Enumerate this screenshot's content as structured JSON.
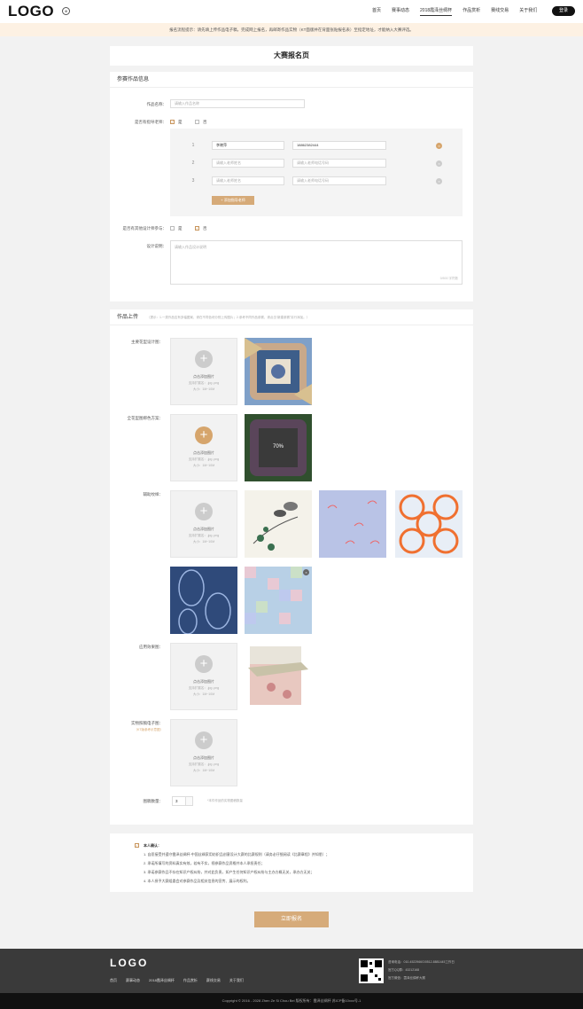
{
  "header": {
    "logo": "LOGO",
    "lang_icon": "globe-icon",
    "nav": [
      "首页",
      "赛事动态",
      "2018霞泽丝绸杯",
      "作品赏析",
      "赛线交易",
      "关于我们"
    ],
    "active_nav": "2018霞泽丝绸杯",
    "login": "登录"
  },
  "notice": "报名流程提示：请先填上传作品电子稿，完成网上报名，再邮寄作品实物（KT面版并在背面张贴报名表）至指定地址，才能纳入大赛评选。",
  "page_title": "大赛报名页",
  "info": {
    "heading": "参赛作品信息",
    "name_label": "作品名称：",
    "name_placeholder": "请输入作品名称",
    "teacher_label": "是否有指导老师：",
    "yes": "是",
    "no": "否",
    "teachers": [
      {
        "num": "1",
        "name": "李晓萍",
        "phone": "18862382444"
      },
      {
        "num": "2",
        "name": "请输入老师姓名",
        "phone": "请输入老师电话号码"
      },
      {
        "num": "3",
        "name": "请输入老师姓名",
        "phone": "请输入老师电话号码"
      }
    ],
    "add_teacher": "+ 添加指导老师",
    "other_label": "是否有其他设计师参与：",
    "desc_label": "设计说明：",
    "desc_placeholder": "请输入作品设计说明",
    "desc_count": "0/500 字符数"
  },
  "upload": {
    "heading": "作品上传",
    "hint": "（提示：1.一类作品应有多幅图案，请在不同色块分别上传图片；2.参考不同作品参赛，请点击“新建参赛”另行添加。）",
    "main_label": "主要花型设计图：",
    "color_label": "全花型图绑色方案：",
    "aux_label": "辅助纹样：",
    "effect_label": "应用效果图：",
    "kt_label": "实物照稿电子图：",
    "kt_note": "（KT版参考示意图）",
    "add_text": "点击添加图片",
    "ext_text": "支持扩展名：.jpg .png",
    "size_text": "大小：1M~10M",
    "progress": "70%",
    "count_label": "图稿数量：",
    "count_value": "3",
    "count_hint": "*本件作品的实物图稿数量"
  },
  "confirm": {
    "title": "本人确认：",
    "items": [
      "1. 自愿接受并遵守霞泽丝绸杯·中国丝绸家用纺织品创意设计大赛的比赛规则（请务必仔细阅读《比赛章程》并知悉）；",
      "2. 承诺所填写的资料真实有效，若有不实，视参赛作品资格并本人承担责任；",
      "3. 承诺参赛作品不存在知识产权纠纷，并对此负责，如产生任何知识产权纠纷与主办方概无关，承办方无关；",
      "4. 本人授予大赛组委会对参赛作品及相关信息的宣传、展示的权利。"
    ]
  },
  "submit": "立即报名",
  "footer": {
    "logo": "LOGO",
    "nav": [
      "首页",
      "赛事动态",
      "2018霞泽丝绸杯",
      "作品赏析",
      "赛线交易",
      "关于我们"
    ],
    "info": [
      "咨询电话：010-4522966G/0512-8881445工作日",
      "官方QQ群：43212168",
      "官方微信：霞泽丝绸杯大赛"
    ],
    "copyright": "Copyright © 2016 - 2028 Zhen Ze Si Chou Bei   版权所有：霞泽丝绸杯   苏ICP备10xxx号-1"
  },
  "colors": {
    "accent": "#d6aa78",
    "dark": "#3a3a3a"
  }
}
